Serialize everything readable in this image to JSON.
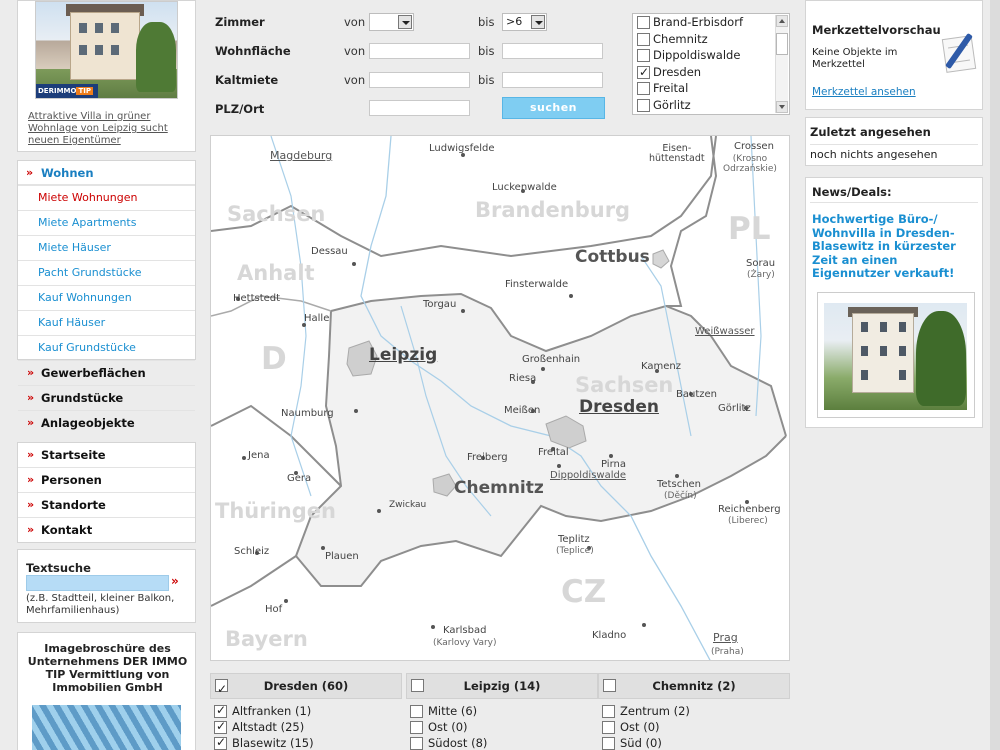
{
  "promo": {
    "logo_prefix": "DERIMMO",
    "logo_suffix": "TIP",
    "caption": "Attraktive Villa in grüner Wohnlage von Leipzig sucht neuen Eigentümer"
  },
  "nav": {
    "wohnen": "Wohnen",
    "sub": [
      "Miete Wohnungen",
      "Miete Apartments",
      "Miete Häuser",
      "Pacht Grundstücke",
      "Kauf Wohnungen",
      "Kauf Häuser",
      "Kauf Grundstücke"
    ],
    "main": [
      "Gewerbeflächen",
      "Grundstücke",
      "Anlageobjekte"
    ],
    "main2": [
      "Startseite",
      "Personen",
      "Standorte",
      "Kontakt"
    ],
    "arrow": "»"
  },
  "textsuche": {
    "title": "Textsuche",
    "hint": "(z.B. Stadtteil, kleiner Balkon, Mehrfamilienhaus)",
    "go": "»"
  },
  "brosch": {
    "title": "Imagebroschüre des Unternehmens DER IMMO TIP Vermittlung von Immobilien GmbH"
  },
  "search": {
    "zimmer": "Zimmer",
    "wohnflaeche": "Wohnfläche",
    "kaltmiete": "Kaltmiete",
    "plz": "PLZ/Ort",
    "von": "von",
    "bis": "bis",
    "zimmer_von": "",
    "zimmer_bis": ">6",
    "button": "suchen"
  },
  "orte": [
    {
      "name": "Brand-Erbisdorf",
      "checked": false
    },
    {
      "name": "Chemnitz",
      "checked": false
    },
    {
      "name": "Dippoldiswalde",
      "checked": false
    },
    {
      "name": "Dresden",
      "checked": true
    },
    {
      "name": "Freital",
      "checked": false
    },
    {
      "name": "Görlitz",
      "checked": false
    }
  ],
  "map": {
    "magdeburg": "Magdeburg",
    "ludwigsfelde": "Ludwigsfelde",
    "eisenhuettenstadt": "Eisen-\nhüttenstadt",
    "crossen": "Crossen",
    "krosno": "(Krosno\nOdrzańskie)",
    "sachsen_anhalt_1": "Sachsen",
    "sachsen_anhalt_2": "Anhalt",
    "brandenburg": "Brandenburg",
    "luckenwalde": "Luckenwalde",
    "pl": "PL",
    "dessau": "Dessau",
    "cottbus": "Cottbus",
    "sorau": "Sorau",
    "zary": "(Żary)",
    "hettstedt": "Hettstedt",
    "finsterwalde": "Finsterwalde",
    "torgau": "Torgau",
    "halle": "Halle",
    "weisswasser": "Weißwasser",
    "d": "D",
    "leipzig": "Leipzig",
    "grossenhain": "Großenhain",
    "kamenz": "Kamenz",
    "riesa": "Riesa",
    "sachsen": "Sachsen",
    "bautzen": "Bautzen",
    "naumburg": "Naumburg",
    "meissen": "Meißen",
    "dresden": "Dresden",
    "goerlitz": "Görlitz",
    "jena": "Jena",
    "freital": "Freital",
    "freiberg": "Freiberg",
    "pirna": "Pirna",
    "gera": "Gera",
    "chemnitz": "Chemnitz",
    "dippoldiswalde": "Dippoldiswalde",
    "tetschen": "Tetschen",
    "decin": "(Děčín)",
    "thueringen": "Thüringen",
    "zwickau": "Zwickau",
    "reichenberg": "Reichenberg",
    "liberec": "(Liberec)",
    "teplitz": "Teplitz",
    "teplice": "(Teplice)",
    "schleiz": "Schleiz",
    "plauen": "Plauen",
    "cz": "CZ",
    "hof": "Hof",
    "bayern": "Bayern",
    "karlsbad": "Karlsbad",
    "karlovy": "(Karlovy Vary)",
    "kladno": "Kladno",
    "prag": "Prag",
    "praha": "(Praha)"
  },
  "districts": [
    {
      "city": "Dresden (60)",
      "checked": true,
      "items": [
        {
          "name": "Altfranken (1)",
          "checked": true
        },
        {
          "name": "Altstadt (25)",
          "checked": true
        },
        {
          "name": "Blasewitz (15)",
          "checked": true
        }
      ]
    },
    {
      "city": "Leipzig (14)",
      "checked": false,
      "items": [
        {
          "name": "Mitte (6)",
          "checked": false
        },
        {
          "name": "Ost (0)",
          "checked": false
        },
        {
          "name": "Südost (8)",
          "checked": false
        }
      ]
    },
    {
      "city": "Chemnitz (2)",
      "checked": false,
      "items": [
        {
          "name": "Zentrum (2)",
          "checked": false
        },
        {
          "name": "Ost (0)",
          "checked": false
        },
        {
          "name": "Süd (0)",
          "checked": false
        }
      ]
    }
  ],
  "merkzettel": {
    "title": "Merkzettelvorschau",
    "text": "Keine Objekte im Merkzettel",
    "link": "Merkzettel ansehen"
  },
  "zuletzt": {
    "title": "Zuletzt angesehen",
    "text": "noch nichts angesehen"
  },
  "news": {
    "title": "News/Deals:",
    "headline": "Hochwertige Büro-/ Wohnvilla in Dresden-Blasewitz in kürzester Zeit an einen Eigennutzer verkauft!"
  }
}
